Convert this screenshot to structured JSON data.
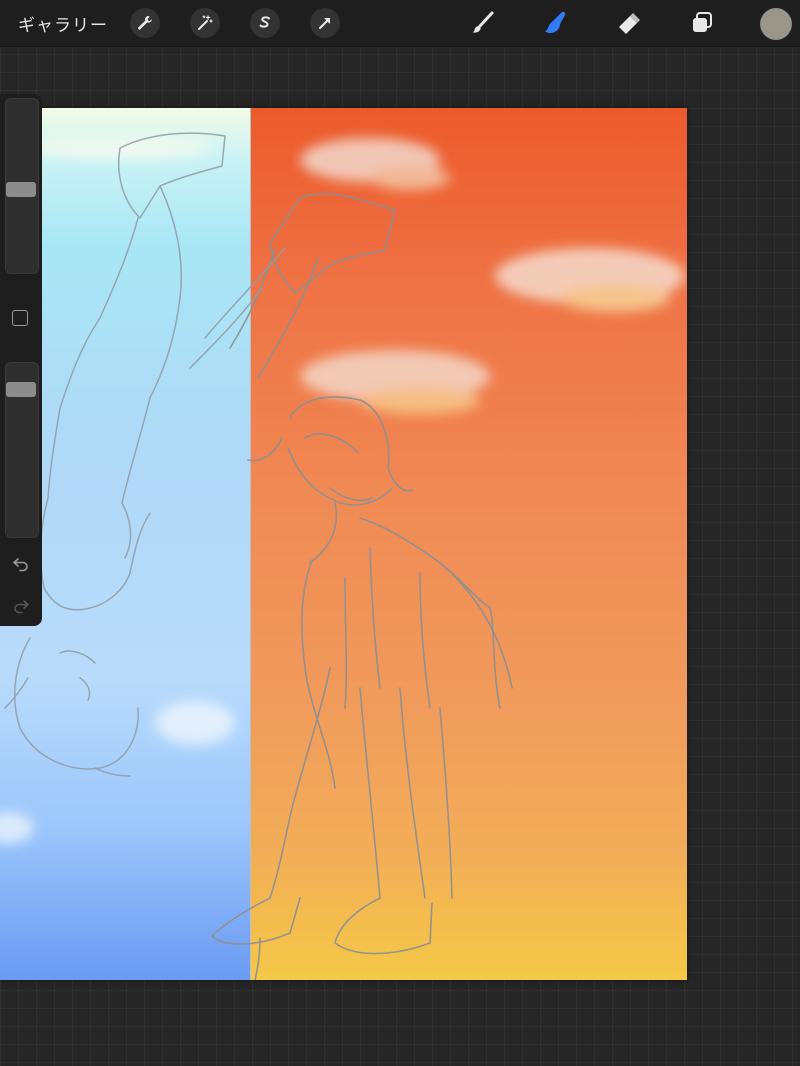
{
  "toolbar": {
    "gallery_label": "ギャラリー",
    "left_tools": [
      {
        "name": "actions",
        "icon": "wrench-icon"
      },
      {
        "name": "adjustments",
        "icon": "magic-wand-icon"
      },
      {
        "name": "selection",
        "icon": "selection-s-icon"
      },
      {
        "name": "transform",
        "icon": "arrow-cursor-icon"
      }
    ],
    "right_tools": [
      {
        "name": "brush",
        "icon": "brush-icon",
        "active": false
      },
      {
        "name": "smudge",
        "icon": "smudge-finger-icon",
        "active": true
      },
      {
        "name": "eraser",
        "icon": "eraser-icon",
        "active": false
      },
      {
        "name": "layers",
        "icon": "layers-icon",
        "active": false
      }
    ],
    "current_color": "#9a968a",
    "active_color": "#2f7cf6"
  },
  "sidebar": {
    "brush_size": 0.47,
    "opacity": 0.88,
    "controls": [
      "modify-square-icon",
      "undo-icon",
      "redo-icon"
    ]
  },
  "canvas": {
    "left_sky_colors": [
      "#f3fbe8",
      "#a9e6f5",
      "#b9dbfb",
      "#6a9af2"
    ],
    "right_sky_colors": [
      "#ec5a2c",
      "#f08a55",
      "#f09b5c",
      "#f4c947"
    ],
    "sketch_color": "#8d8f91"
  }
}
